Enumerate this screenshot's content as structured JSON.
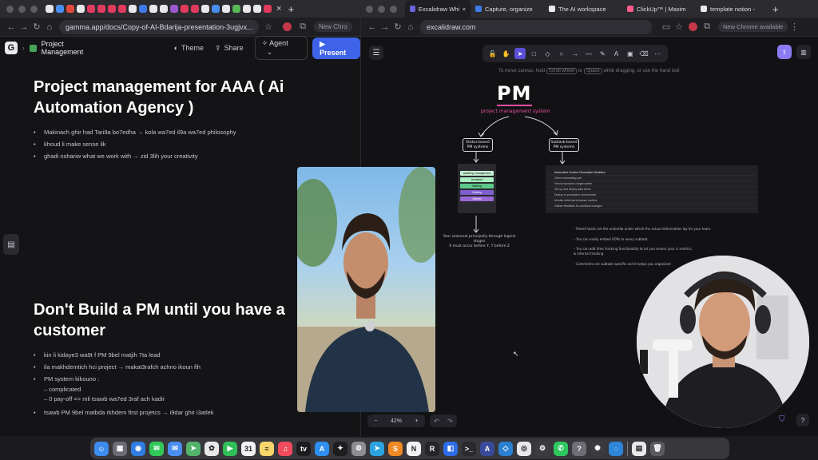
{
  "left_window": {
    "tab_close": "×",
    "tab_plus": "+",
    "url": "gamma.app/docs/Copy-of-AI-Bdarija-presentation-3ugjvx...",
    "new_chrome": "New Chro",
    "gamma": {
      "logo": "G",
      "project_title": "Project Management",
      "theme_label": "Theme",
      "share_label": "Share",
      "agent_label": "Agent",
      "present_label": "Present"
    },
    "slide1": {
      "heading": "Project management for AAA ( Ai Automation Agency )",
      "bullets": [
        "Makinach ghir had Tari9a bo7edha → kola wa7ed il9a wa7ed philosophy",
        "khoud li make sense lik",
        "ghadi nshariw what we work with → zid 3lih your creativity"
      ]
    },
    "slide2": {
      "heading": "Don't Build a PM until you have a customer",
      "bullets": [
        "kin li kidaye3 wa9t f PM 9bel matjih 7ta lead",
        "ila makhdemtich hci project → makat3rafch achno ikoun fih",
        "PM system kikouno :",
        "– complicated",
        "– 0 pay-off => mli tsawb wa7ed 3raf ach kadir",
        "tsawb PM 9bel matbda rkhdem first projetcs → i9dar ghir i3atlek"
      ]
    }
  },
  "right_window": {
    "tabs": [
      {
        "label": "Excalidraw Whitel",
        "color": "#6965db"
      },
      {
        "label": "Capture, organize",
        "color": "#3f7be8"
      },
      {
        "label": "The AI workspace",
        "color": "#e9e9ee"
      },
      {
        "label": "ClickUp™ | Maxim",
        "color": "#ff5c8a"
      },
      {
        "label": "template notion -",
        "color": "#e9e9ee"
      }
    ],
    "tab_plus": "+",
    "url": "excalidraw.com",
    "new_chrome": "New Chrome available",
    "canvas": {
      "hint_pre": "To move canvas, hold",
      "hint_key1": "Scroll wheel",
      "hint_mid": "or",
      "hint_key2": "Space",
      "hint_post": "while dragging, or use the hand tool",
      "pm_title": "PM",
      "pm_subtitle": "project management system",
      "status_box": "Status-based\nPM systems",
      "subtask_box": "Subtask-based\nPM systems",
      "status_rows": [
        "Awaiting management",
        "Accepted",
        "Waiting",
        "Holding",
        "Started"
      ],
      "status_note_1": "Your seasonal principally through logical stages",
      "status_note_2": "X must occur before Y, Y before Z",
      "notes": [
        "– Parent tasks are the umbrella under which the actual deliverables lay for your team.",
        "– You can easily embed SOPs to every subtask",
        "– You can add time tracking functionality to let you assess your cl metrics,",
        "   & internal tracking",
        "– Comments are subtask-specific and it keeps you organized"
      ],
      "table_rows": [
        "Automated Content Generation Workflow",
        "Client onboarding call",
        "Send proposal to single admin",
        "Set up and deploy data demo",
        "Deploy to production environment",
        "Monitor initial performance metrics",
        "Gather feedback for workflow changes"
      ]
    },
    "zoom": "42%",
    "zoom_minus": "−",
    "zoom_plus": "+"
  },
  "dock": {
    "icons": [
      {
        "name": "finder-icon",
        "color": "#3d8cf0",
        "glyph": "☺"
      },
      {
        "name": "launchpad-icon",
        "color": "#6b6b75",
        "glyph": "▦"
      },
      {
        "name": "safari-icon",
        "color": "#2f7de1",
        "glyph": "◉"
      },
      {
        "name": "messages-icon",
        "color": "#32c759",
        "glyph": "✉"
      },
      {
        "name": "mail-icon",
        "color": "#4a8ff0",
        "glyph": "✉"
      },
      {
        "name": "maps-icon",
        "color": "#54b36b",
        "glyph": "➤"
      },
      {
        "name": "photos-icon",
        "color": "#e8e8ea",
        "glyph": "✿"
      },
      {
        "name": "facetime-icon",
        "color": "#2fbf56",
        "glyph": "▶"
      },
      {
        "name": "calendar-icon",
        "color": "#f2f2f4",
        "glyph": "31"
      },
      {
        "name": "notes-icon",
        "color": "#f6d66b",
        "glyph": "≡"
      },
      {
        "name": "music-icon",
        "color": "#f24b5d",
        "glyph": "♫"
      },
      {
        "name": "tv-icon",
        "color": "#1c1c1e",
        "glyph": "tv"
      },
      {
        "name": "app-store-icon",
        "color": "#2f8ff0",
        "glyph": "A"
      },
      {
        "name": "figma-icon",
        "color": "#1d1d1f",
        "glyph": "✦"
      },
      {
        "name": "settings-icon",
        "color": "#8d8d94",
        "glyph": "⚙"
      },
      {
        "name": "telegram-icon",
        "color": "#2aa3e0",
        "glyph": "➤"
      },
      {
        "name": "sublime-icon",
        "color": "#f08a24",
        "glyph": "S"
      },
      {
        "name": "notion-icon",
        "color": "#f2f2f4",
        "glyph": "N"
      },
      {
        "name": "r-app-icon",
        "color": "#26262a",
        "glyph": "R"
      },
      {
        "name": "capture-icon",
        "color": "#2f6de8",
        "glyph": "◧"
      },
      {
        "name": "terminal-icon",
        "color": "#2a2a2e",
        "glyph": ">_"
      },
      {
        "name": "affinity-icon",
        "color": "#3a4a9a",
        "glyph": "A"
      },
      {
        "name": "vscode-icon",
        "color": "#2a7fd0",
        "glyph": "◇"
      },
      {
        "name": "chrome-icon",
        "color": "#e9e9ec",
        "glyph": "◎"
      },
      {
        "name": "cog-app-icon",
        "color": "#3b3b40",
        "glyph": "⚙"
      },
      {
        "name": "whatsapp-icon",
        "color": "#2ec75e",
        "glyph": "✆"
      },
      {
        "name": "help-icon",
        "color": "#6e6e76",
        "glyph": "?"
      },
      {
        "name": "chatgpt-icon",
        "color": "#3a3a40",
        "glyph": "✺"
      },
      {
        "name": "screenshot-icon",
        "color": "#2e86d8",
        "glyph": "◌"
      },
      {
        "name": "document-icon",
        "color": "#e9e9ec",
        "glyph": "▤"
      },
      {
        "name": "trash-icon",
        "color": "#5a5a60",
        "glyph": "🗑"
      }
    ]
  }
}
